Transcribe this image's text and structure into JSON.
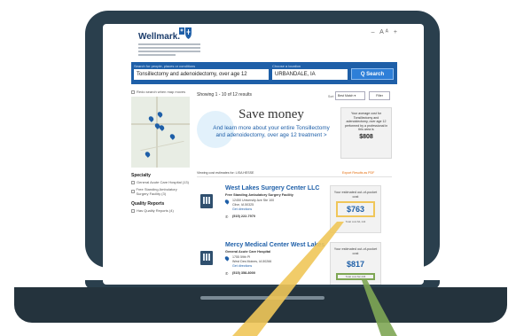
{
  "header": {
    "brand": "Wellmark.",
    "tools": "– Aᴬ +"
  },
  "search": {
    "query_label": "Search for people, places or conditions",
    "query_value": "Tonsillectomy and adenoidectomy, over age 12",
    "location_label": "Choose a location",
    "location_value": "URBANDALE, IA",
    "button_label": "Q Search"
  },
  "sidebar": {
    "redo_label": "Redo search when map moves",
    "specialty_title": "Specialty",
    "specialty_items": [
      "General Acute Care Hospital (13)",
      "Free Standing Ambulatory Surgery Facility (3)"
    ],
    "quality_title": "Quality Reports",
    "quality_items": [
      "Has Quality Reports (4)"
    ]
  },
  "results": {
    "count_text": "Showing 1 - 10 of 12 results",
    "sort_label": "Sort",
    "sort_value": "Best Match",
    "filter_label": "Filter",
    "viewing_text": "Viewing cost estimates for: LISA HESSE",
    "export_label": "Export Results as PDF"
  },
  "promo": {
    "title": "Save money",
    "body": "And learn more about your entire Tonsillectomy and adenoidectomy, over age 12 treatment >"
  },
  "average": {
    "text": "Your average cost for Tonsillectomy and adenoidectomy, over age 12 performed by a professional in this area is",
    "amount": "$808"
  },
  "cards": [
    {
      "name": "West Lakes Surgery Center LLC",
      "type": "Free Standing Ambulatory Surgery Facility",
      "address": "12450 University Ave Ste 100\nClive, IA 50325",
      "directions": "Get directions",
      "phone": "(515) 222-7970",
      "cost_label": "Your estimated out-of-pocket cost",
      "cost": "$763",
      "cost_sub": "Total cost $1,144"
    },
    {
      "name": "Mercy Medical Center West Lakes",
      "type": "General Acute Care Hospital",
      "address": "1755 59th Pl\nWest Des Moines, IA 50266",
      "directions": "Get directions",
      "phone": "(515) 358-8000",
      "cost_label": "Your estimated out-of-pocket cost",
      "cost": "$817",
      "cost_sub": "Total cost $2,446"
    }
  ],
  "colors": {
    "frame": "#2a3f4d",
    "brand_blue": "#1e5fa8",
    "highlight_yellow": "#f0c659",
    "highlight_green": "#7ea654"
  }
}
